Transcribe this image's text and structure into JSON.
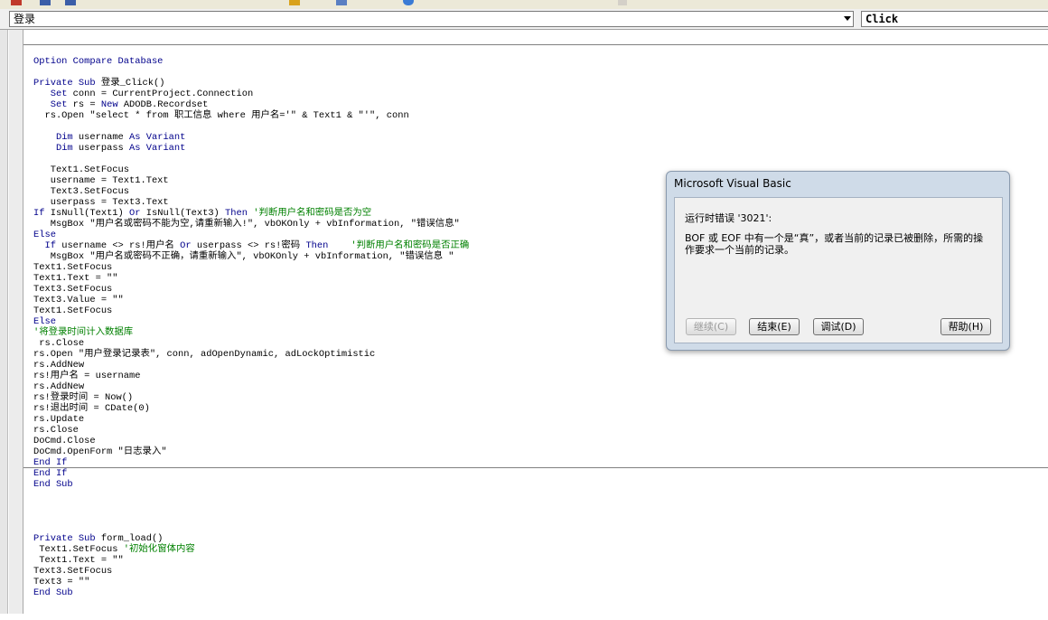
{
  "procedure_bar": {
    "object_value": "登录",
    "procedure_value": "Click"
  },
  "code_block1": [
    [
      {
        "t": "Option Compare Database",
        "c": "kw"
      }
    ],
    [],
    [
      {
        "t": "Private Sub ",
        "c": "kw"
      },
      {
        "t": "登录_Click()"
      }
    ],
    [
      {
        "t": "   "
      },
      {
        "t": "Set",
        "c": "kw"
      },
      {
        "t": " conn = CurrentProject.Connection"
      }
    ],
    [
      {
        "t": "   "
      },
      {
        "t": "Set",
        "c": "kw"
      },
      {
        "t": " rs = "
      },
      {
        "t": "New",
        "c": "kw"
      },
      {
        "t": " ADODB.Recordset"
      }
    ],
    [
      {
        "t": "  rs.Open \"select * from 职工信息 where 用户名='\" & Text1 & \"'\", conn"
      }
    ],
    [],
    [
      {
        "t": "    "
      },
      {
        "t": "Dim",
        "c": "kw"
      },
      {
        "t": " username "
      },
      {
        "t": "As Variant",
        "c": "kw"
      }
    ],
    [
      {
        "t": "    "
      },
      {
        "t": "Dim",
        "c": "kw"
      },
      {
        "t": " userpass "
      },
      {
        "t": "As Variant",
        "c": "kw"
      }
    ],
    [],
    [
      {
        "t": "   Text1.SetFocus"
      }
    ],
    [
      {
        "t": "   username = Text1.Text"
      }
    ],
    [
      {
        "t": "   Text3.SetFocus"
      }
    ],
    [
      {
        "t": "   userpass = Text3.Text"
      }
    ],
    [
      {
        "t": "If",
        "c": "kw"
      },
      {
        "t": " IsNull(Text1) "
      },
      {
        "t": "Or",
        "c": "kw"
      },
      {
        "t": " IsNull(Text3) "
      },
      {
        "t": "Then",
        "c": "kw"
      },
      {
        "t": " '判断用户名和密码是否为空",
        "c": "cm"
      }
    ],
    [
      {
        "t": "   MsgBox \"用户名或密码不能为空,请重新输入!\", vbOKOnly + vbInformation, \"错误信息\""
      }
    ],
    [
      {
        "t": "Else",
        "c": "kw"
      }
    ],
    [
      {
        "t": "  "
      },
      {
        "t": "If",
        "c": "kw"
      },
      {
        "t": " username <> rs!用户名 "
      },
      {
        "t": "Or",
        "c": "kw"
      },
      {
        "t": " userpass <> rs!密码 "
      },
      {
        "t": "Then",
        "c": "kw"
      },
      {
        "t": "    '判断用户名和密码是否正确",
        "c": "cm"
      }
    ],
    [
      {
        "t": "   MsgBox \"用户名或密码不正确，请重新输入\", vbOKOnly + vbInformation, \"错误信息 \""
      }
    ],
    [
      {
        "t": "Text1.SetFocus"
      }
    ],
    [
      {
        "t": "Text1.Text = \"\""
      }
    ],
    [
      {
        "t": "Text3.SetFocus"
      }
    ],
    [
      {
        "t": "Text3.Value = \"\""
      }
    ],
    [
      {
        "t": "Text1.SetFocus"
      }
    ],
    [
      {
        "t": "Else",
        "c": "kw"
      }
    ],
    [
      {
        "t": "'将登录时间计入数据库",
        "c": "cm"
      }
    ],
    [
      {
        "t": " rs.Close"
      }
    ],
    [
      {
        "t": "rs.Open \"用户登录记录表\", conn, adOpenDynamic, adLockOptimistic"
      }
    ],
    [
      {
        "t": "rs.AddNew"
      }
    ],
    [
      {
        "t": "rs!用户名 = username"
      }
    ],
    [
      {
        "t": "rs.AddNew"
      }
    ],
    [
      {
        "t": "rs!登录时间 = Now()"
      }
    ],
    [
      {
        "t": "rs!退出时间 = CDate(0)"
      }
    ],
    [
      {
        "t": "rs.Update"
      }
    ],
    [
      {
        "t": "rs.Close"
      }
    ],
    [
      {
        "t": "DoCmd.Close"
      }
    ],
    [
      {
        "t": "DoCmd.OpenForm \"日志录入\""
      }
    ],
    [
      {
        "t": "End If",
        "c": "kw"
      }
    ],
    [
      {
        "t": "End If",
        "c": "kw"
      }
    ],
    [
      {
        "t": "End Sub",
        "c": "kw"
      }
    ]
  ],
  "code_block2": [
    [],
    [],
    [
      {
        "t": "Private Sub ",
        "c": "kw"
      },
      {
        "t": "form_load()"
      }
    ],
    [
      {
        "t": " Text1.SetFocus "
      },
      {
        "t": "'初始化窗体内容",
        "c": "cm"
      }
    ],
    [
      {
        "t": " Text1.Text = \"\""
      }
    ],
    [
      {
        "t": "Text3.SetFocus"
      }
    ],
    [
      {
        "t": "Text3 = \"\""
      }
    ],
    [
      {
        "t": "End Sub",
        "c": "kw"
      }
    ]
  ],
  "dialog": {
    "title": "Microsoft Visual Basic",
    "error_line": "运行时错误 '3021':",
    "message": "BOF 或 EOF 中有一个是“真”，或者当前的记录已被删除，所需的操作要求一个当前的记录。",
    "buttons": {
      "continue": "继续(C)",
      "end": "结束(E)",
      "debug": "调试(D)",
      "help": "帮助(H)"
    }
  }
}
